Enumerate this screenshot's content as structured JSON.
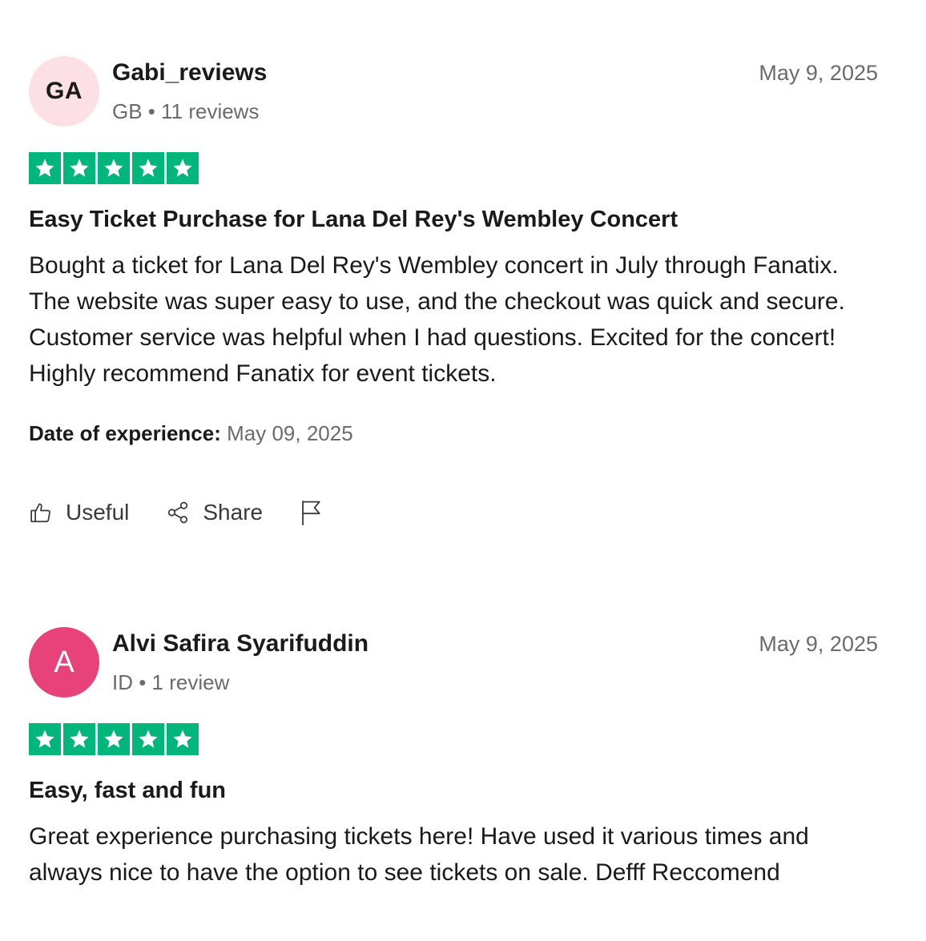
{
  "colors": {
    "star_green": "#00b67a",
    "avatar_pink_light": "#fde0e6",
    "avatar_pink_strong": "#e8427b",
    "muted_text": "#6b6b6b"
  },
  "reviews": [
    {
      "avatar_text": "GA",
      "avatar_color": "#fde0e6",
      "name": "Gabi_reviews",
      "meta": "GB • 11 reviews",
      "date": "May 9, 2025",
      "rating": 5,
      "title": "Easy Ticket Purchase for Lana Del Rey's Wembley Concert",
      "body": "Bought a ticket for Lana Del Rey's Wembley concert in July through Fanatix. The website was super easy to use, and the checkout was quick and secure. Customer service was helpful when I had questions. Excited for the concert! Highly recommend Fanatix for event tickets.",
      "experience_label": "Date of experience:",
      "experience_date": "May 09, 2025",
      "actions": {
        "useful": "Useful",
        "share": "Share",
        "report_icon": "flag-icon"
      }
    },
    {
      "avatar_text": "A",
      "avatar_color": "#e8427b",
      "name": "Alvi Safira Syarifuddin",
      "meta": "ID • 1 review",
      "date": "May 9, 2025",
      "rating": 5,
      "title": "Easy, fast and fun",
      "body": "Great experience purchasing tickets here! Have used it various times and always nice to have the option to see tickets on sale. Defff Reccomend"
    }
  ]
}
